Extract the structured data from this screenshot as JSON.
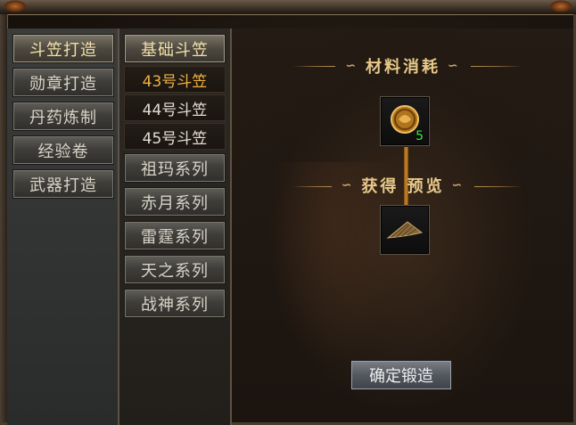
{
  "categories": [
    "斗笠打造",
    "勋章打造",
    "丹药炼制",
    "经验卷",
    "武器打造"
  ],
  "active_category": 0,
  "subitems": [
    {
      "label": "基础斗笠",
      "type": "group"
    },
    {
      "label": "43号斗笠",
      "type": "item",
      "active": true
    },
    {
      "label": "44号斗笠",
      "type": "item"
    },
    {
      "label": "45号斗笠",
      "type": "item"
    },
    {
      "label": "祖玛系列",
      "type": "group"
    },
    {
      "label": "赤月系列",
      "type": "group"
    },
    {
      "label": "雷霆系列",
      "type": "group"
    },
    {
      "label": "天之系列",
      "type": "group"
    },
    {
      "label": "战神系列",
      "type": "group"
    }
  ],
  "materials": {
    "title": "材料消耗",
    "item_icon": "coin-medallion-icon",
    "count": "5"
  },
  "preview": {
    "title": "获得 预览",
    "item_icon": "bamboo-hat-icon"
  },
  "confirm_label": "确定锻造",
  "colors": {
    "active_sub": "#f0b040",
    "count": "#38e838",
    "title": "#e8c98a"
  }
}
